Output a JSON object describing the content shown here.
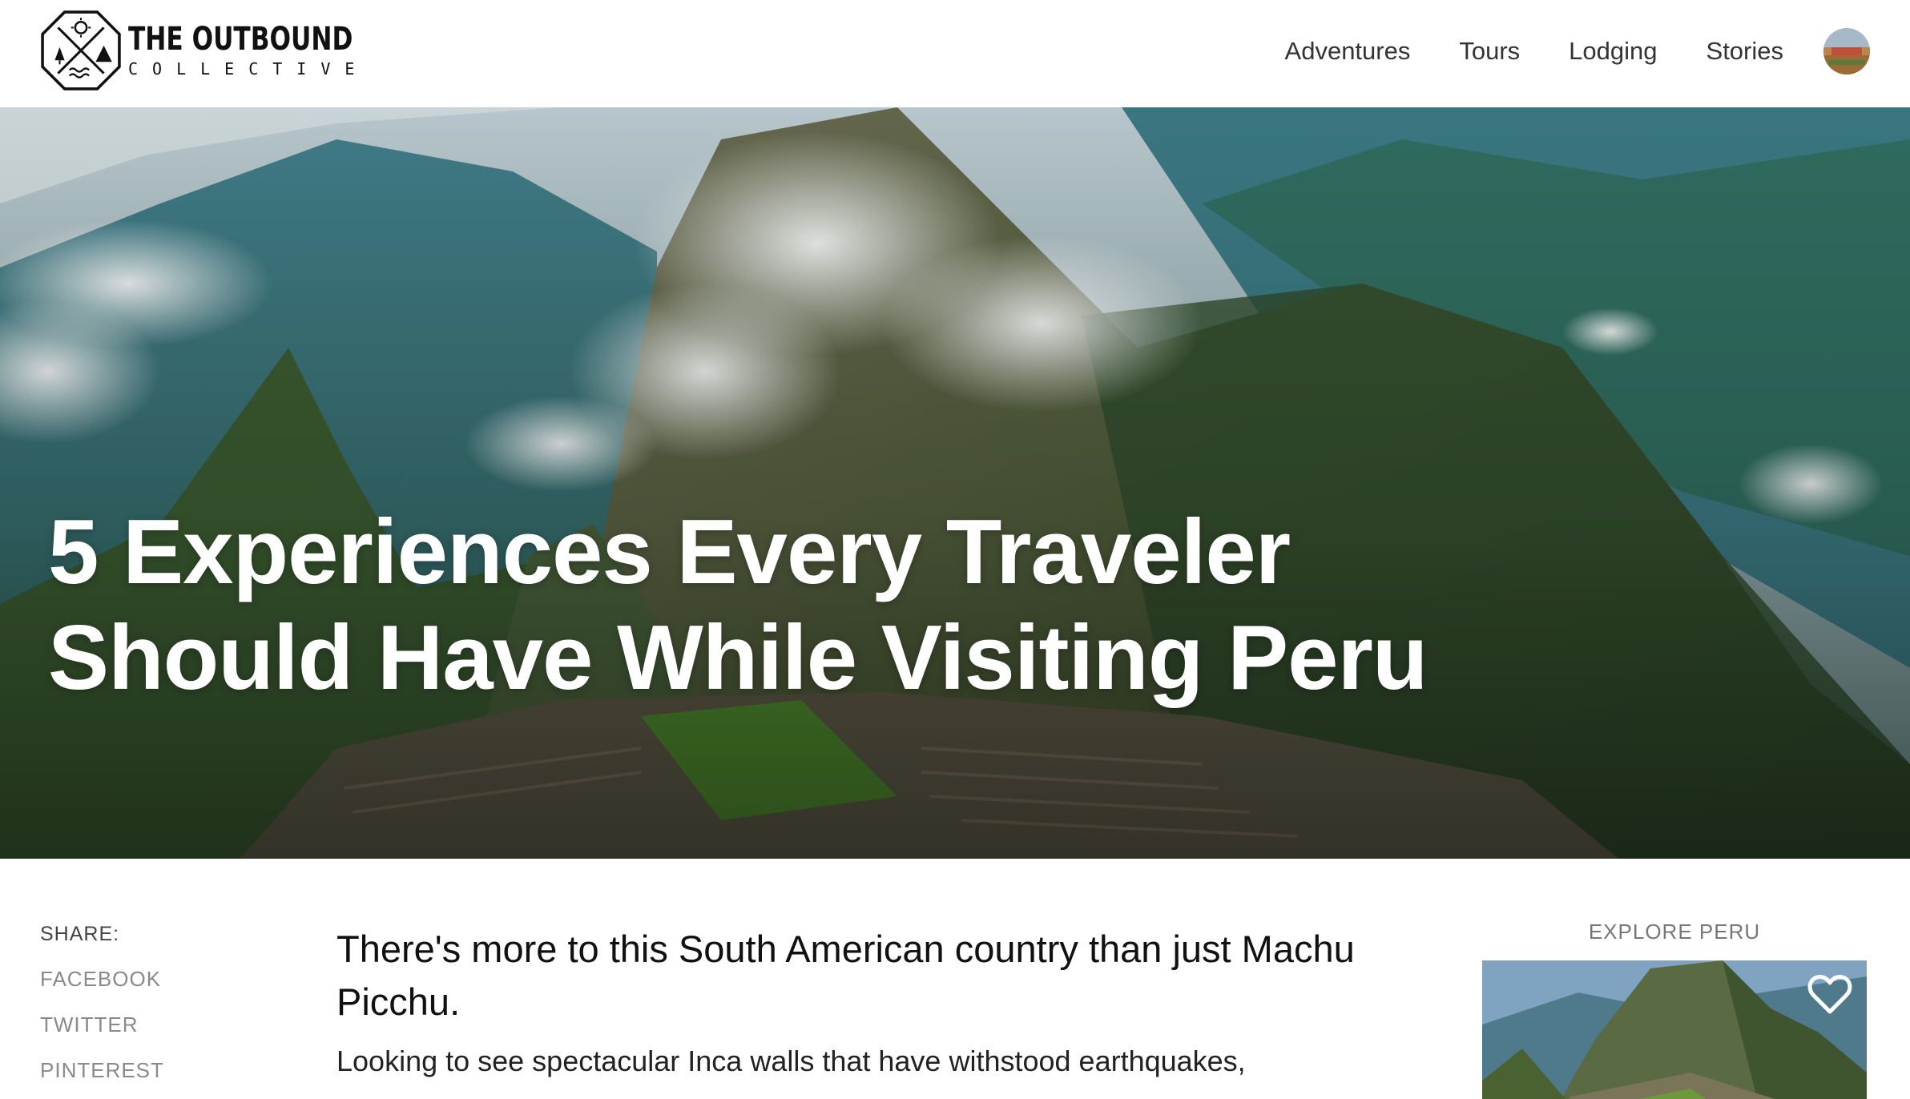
{
  "brand": {
    "name_line1": "THE OUTBOUND",
    "name_line2": "COLLECTIVE"
  },
  "nav": {
    "items": [
      {
        "label": "Adventures"
      },
      {
        "label": "Tours"
      },
      {
        "label": "Lodging"
      },
      {
        "label": "Stories"
      }
    ]
  },
  "hero": {
    "title": "5 Experiences Every Traveler Should Have While Visiting Peru"
  },
  "share": {
    "label": "SHARE:",
    "links": [
      {
        "label": "FACEBOOK"
      },
      {
        "label": "TWITTER"
      },
      {
        "label": "PINTEREST"
      }
    ]
  },
  "article": {
    "lede": "There's more to this South American country than just Machu Picchu.",
    "body": "Looking to see spectacular Inca walls that have withstood earthquakes,"
  },
  "sidebar": {
    "explore_label": "EXPLORE PERU"
  },
  "icons": {
    "logo": "compass-mountains-logo-icon",
    "favorite": "heart-icon",
    "avatar": "user-avatar"
  },
  "colors": {
    "text": "#222222",
    "muted": "#8a8a8a",
    "hero_overlay_text": "#ffffff"
  }
}
